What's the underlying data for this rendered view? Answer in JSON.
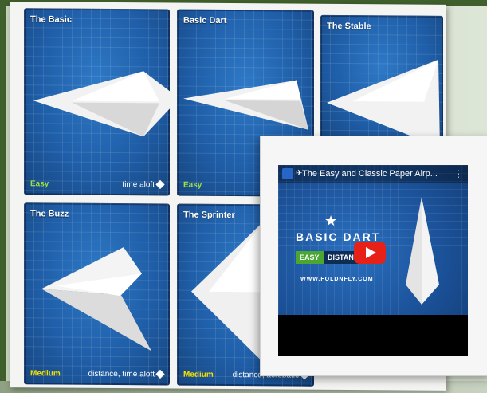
{
  "cards": [
    {
      "title": "The Basic",
      "level": "Easy",
      "tags": "time aloft",
      "level_class": "easy"
    },
    {
      "title": "Basic Dart",
      "level": "Easy",
      "tags": "",
      "level_class": "easy"
    },
    {
      "title": "The Stable",
      "level": "",
      "tags": "",
      "level_class": "easy"
    },
    {
      "title": "The Buzz",
      "level": "Medium",
      "tags": "distance, time aloft",
      "level_class": "med"
    },
    {
      "title": "The Sprinter",
      "level": "Medium",
      "tags": "distance, acrobatic",
      "level_class": "med"
    }
  ],
  "video": {
    "title": "The Easy and Classic Paper Airp...",
    "heading": "BASIC DART",
    "badge_easy": "EASY",
    "badge_distance": "DISTANCE",
    "url": "WWW.FOLDNFLY.COM"
  },
  "colors": {
    "frame_green": "#3f5f2c",
    "card_blue": "#1f5ea8",
    "easy_green": "#9ee04a",
    "medium_yellow": "#f4e000",
    "play_red": "#e62117"
  }
}
